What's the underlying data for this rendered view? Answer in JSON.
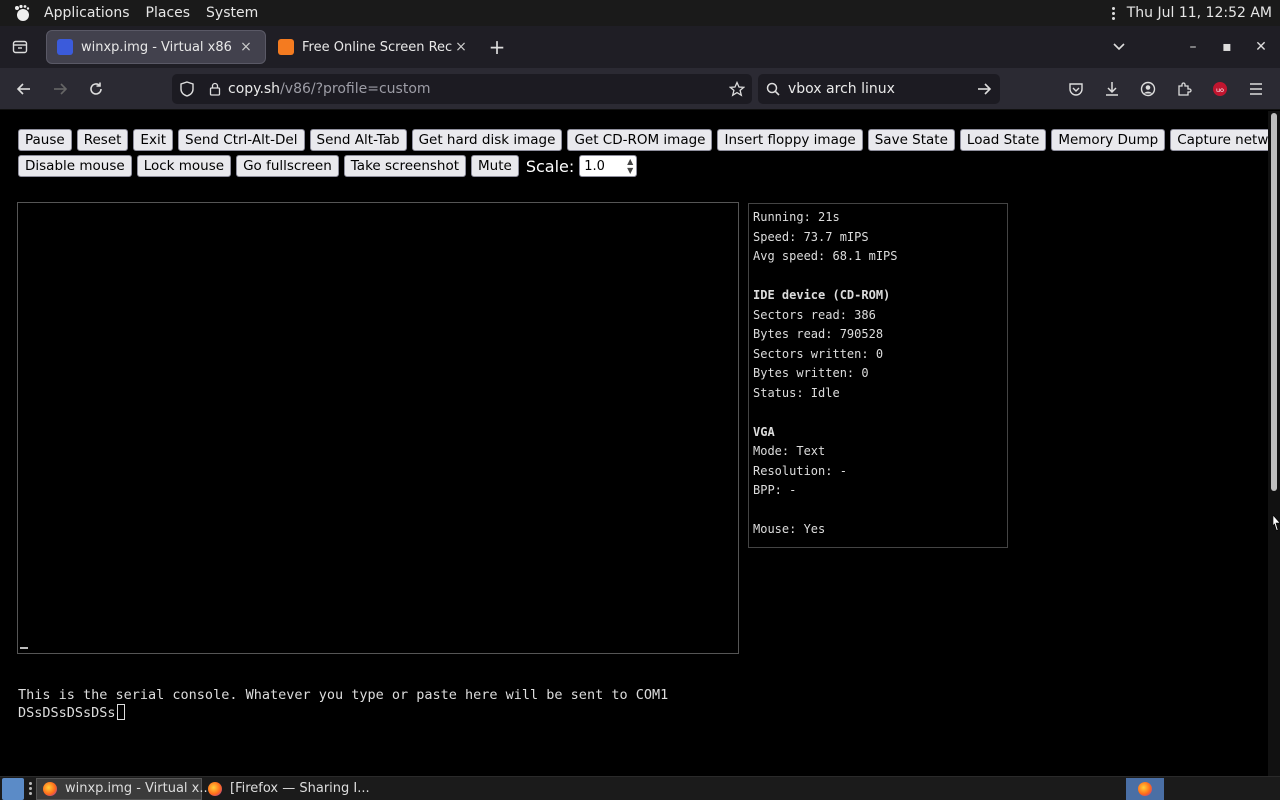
{
  "system_panel": {
    "menus": [
      "Applications",
      "Places",
      "System"
    ],
    "clock": "Thu Jul 11, 12:52 AM"
  },
  "tabs": [
    {
      "title": "winxp.img - Virtual x86",
      "close": "×"
    },
    {
      "title": "Free Online Screen Recorder",
      "close": "×"
    }
  ],
  "new_tab": "+",
  "window_controls": {
    "minimize": "–",
    "maximize": "▪",
    "close": "✕"
  },
  "url": {
    "host": "copy.sh",
    "path": "/v86/?profile=custom"
  },
  "search": {
    "value": "vbox arch linux"
  },
  "buttons_row1": [
    "Pause",
    "Reset",
    "Exit",
    "Send Ctrl-Alt-Del",
    "Send Alt-Tab",
    "Get hard disk image",
    "Get CD-ROM image",
    "Insert floppy image",
    "Save State",
    "Load State",
    "Memory Dump",
    "Capture network traffic"
  ],
  "buttons_row2": [
    "Disable mouse",
    "Lock mouse",
    "Go fullscreen",
    "Take screenshot",
    "Mute"
  ],
  "scale": {
    "label": "Scale:",
    "value": "1.0"
  },
  "info": {
    "running": "Running: 21s",
    "speed": "Speed: 73.7 mIPS",
    "avg_speed": "Avg speed: 68.1 mIPS",
    "ide_heading": "IDE device (CD-ROM)",
    "sectors_read": "Sectors read: 386",
    "bytes_read": "Bytes read: 790528",
    "sectors_written": "Sectors written: 0",
    "bytes_written": "Bytes written: 0",
    "status": "Status: Idle",
    "vga_heading": "VGA",
    "mode": "Mode: Text",
    "resolution": "Resolution: -",
    "bpp": "BPP: -",
    "mouse": "Mouse: Yes"
  },
  "serial": {
    "line1": "This is the serial console. Whatever you type or paste here will be sent to COM1",
    "line2": "DSsDSsDSsDSs"
  },
  "taskbar": {
    "items": [
      "winxp.img - Virtual x...",
      "[Firefox — Sharing I..."
    ]
  },
  "colors": {
    "accent_ublock": "#c0152f",
    "firefox_orange": "#ff7139"
  }
}
